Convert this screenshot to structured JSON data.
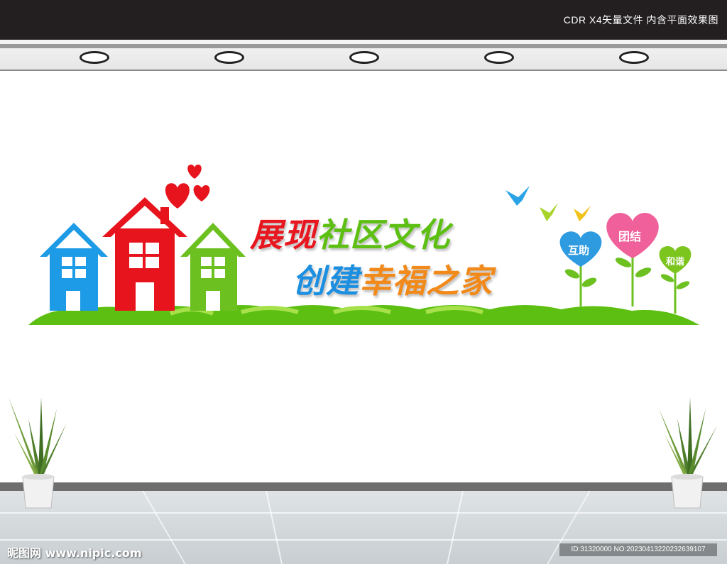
{
  "header": {
    "caption": "CDR X4矢量文件  内含平面效果图"
  },
  "headline": {
    "line1": {
      "part1": "展现",
      "part2": "社区文化"
    },
    "line2": {
      "part1": "创建",
      "part2": "幸福之家"
    }
  },
  "heart_flowers": [
    {
      "label": "互助",
      "color": "#2e9be0"
    },
    {
      "label": "团结",
      "color": "#f0609a"
    },
    {
      "label": "和谐",
      "color": "#7cc51f"
    }
  ],
  "colors": {
    "red": "#e8161f",
    "green": "#5cbf12",
    "blue": "#1d8fe0",
    "orange": "#f18a1a",
    "house_blue": "#1d9be6",
    "house_red": "#e8141d",
    "house_green": "#6cc020"
  },
  "watermark": {
    "left": "昵图网 www.nipic.com",
    "right": "ID:31320000 NO:20230413220232639107"
  }
}
